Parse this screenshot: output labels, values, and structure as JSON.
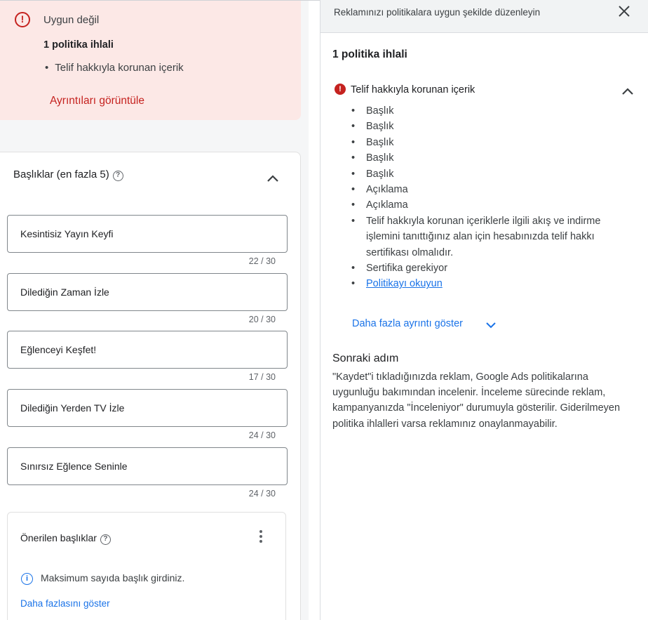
{
  "alert": {
    "status": "Uygun değil",
    "violation_count": "1 politika ihlali",
    "item": "Telif hakkıyla korunan içerik",
    "details_link": "Ayrıntıları görüntüle"
  },
  "headlines": {
    "title": "Başlıklar (en fazla 5)",
    "fields": [
      {
        "value": "Kesintisiz Yayın Keyfi",
        "count": "22 / 30"
      },
      {
        "value": "Dilediğin Zaman İzle",
        "count": "20 / 30"
      },
      {
        "value": "Eğlenceyi Keşfet!",
        "count": "17 / 30"
      },
      {
        "value": "Dilediğin Yerden TV İzle",
        "count": "24 / 30"
      },
      {
        "value": "Sınırsız Eğlence Seninle",
        "count": "24 / 30"
      }
    ]
  },
  "suggested": {
    "title": "Önerilen başlıklar",
    "info": "Maksimum sayıda başlık girdiniz.",
    "more_link": "Daha fazlasını göster"
  },
  "panel": {
    "header_title": "Reklamınızı politikalara uygun şekilde düzenleyin",
    "violation_count": "1 politika ihlali",
    "violation_title": "Telif hakkıyla korunan içerik",
    "list": [
      "Başlık",
      "Başlık",
      "Başlık",
      "Başlık",
      "Başlık",
      "Açıklama",
      "Açıklama",
      "Telif hakkıyla korunan içeriklerle ilgili akış ve indirme işlemini tanıttığınız alan için hesabınızda telif hakkı sertifikası olmalıdır.",
      "Sertifika gerekiyor"
    ],
    "policy_link": "Politikayı okuyun",
    "details_link": "Daha fazla ayrıntı göster",
    "next_title": "Sonraki adım",
    "next_body": "\"Kaydet\"i tıkladığınızda reklam, Google Ads politikalarına uygunluğu bakımından incelenir. İnceleme sürecinde reklam, kampanyanızda \"İnceleniyor\" durumuyla gösterilir. Giderilmeyen politika ihlalleri varsa reklamınız onaylanmayabilir."
  },
  "colors": {
    "error": "#c5221f",
    "alert_bg": "#fce8e6",
    "link": "#1a73e8"
  }
}
